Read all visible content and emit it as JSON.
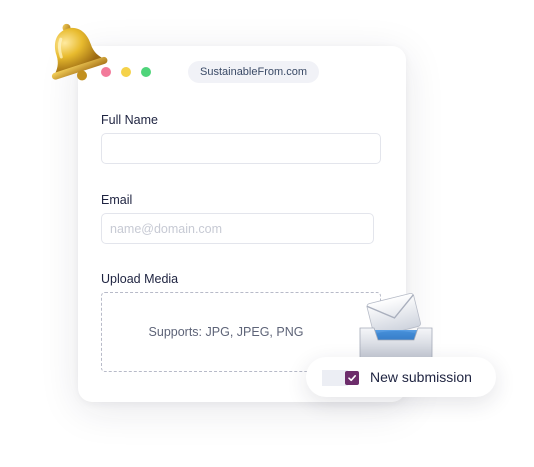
{
  "browser": {
    "url": "SustainableFrom.com"
  },
  "form": {
    "full_name": {
      "label": "Full Name",
      "value": "",
      "placeholder": ""
    },
    "email": {
      "label": "Email",
      "value": "",
      "placeholder": "name@domain.com"
    },
    "upload": {
      "label": "Upload Media",
      "hint": "Supports: JPG, JPEG, PNG"
    }
  },
  "notification": {
    "text": "New submission",
    "checked": true
  },
  "icons": {
    "bell": "bell-icon",
    "mailbox": "mailbox-icon",
    "checkbox": "check-icon"
  },
  "colors": {
    "window_close": "#f27a9a",
    "window_minimize": "#f5d24a",
    "window_maximize": "#4fd47a",
    "check_fill": "#6d2d6b",
    "bell_gold": "#e3b52a",
    "mail_blue": "#2b6fb8"
  }
}
